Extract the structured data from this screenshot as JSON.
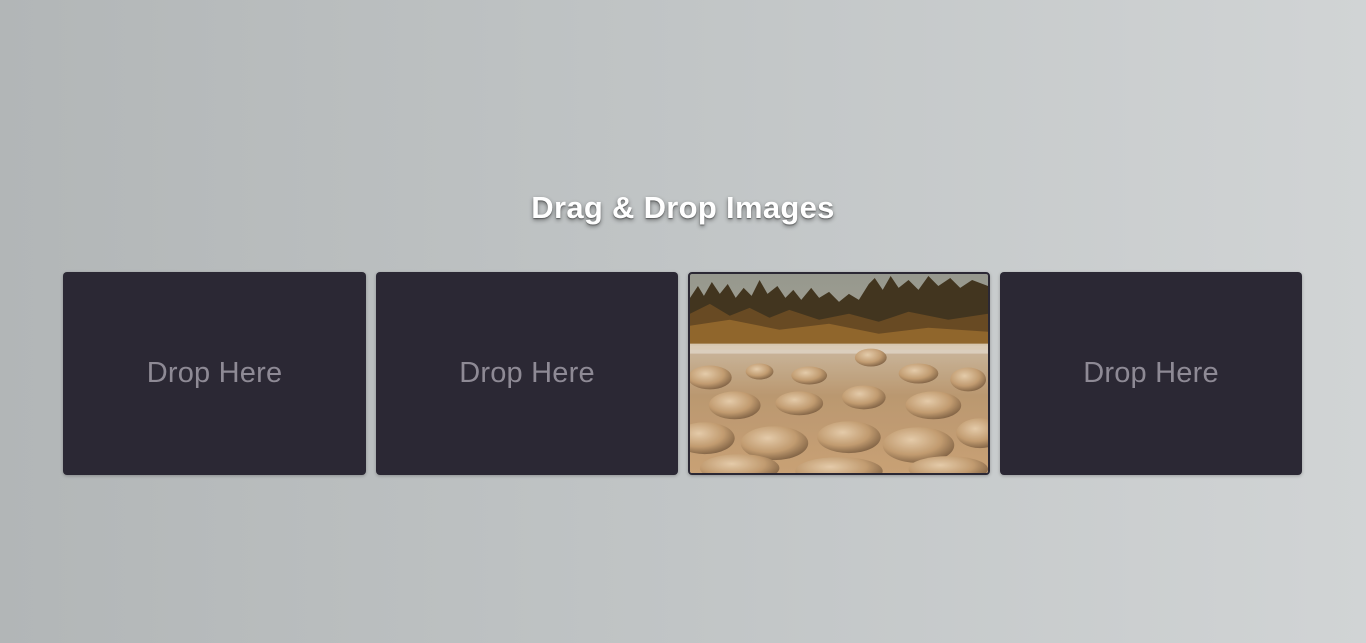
{
  "heading": "Drag & Drop Images",
  "slots": [
    {
      "label": "Drop Here",
      "filled": false
    },
    {
      "label": "Drop Here",
      "filled": false
    },
    {
      "label": "",
      "filled": true,
      "image": "rocky-riverbed-forest-photo"
    },
    {
      "label": "Drop Here",
      "filled": false
    }
  ],
  "colors": {
    "slot_bg": "#2b2834",
    "slot_text": "#8e8a95",
    "heading": "#ffffff"
  }
}
